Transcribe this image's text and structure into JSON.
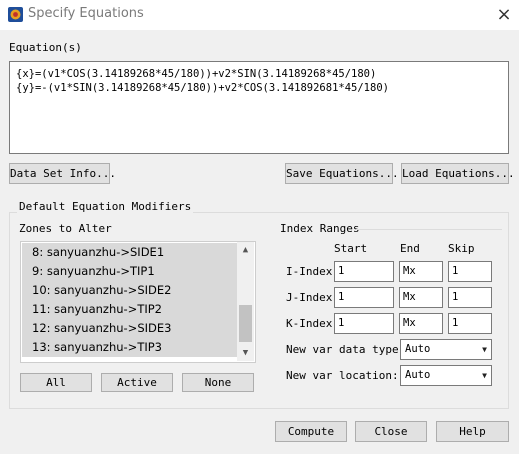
{
  "window": {
    "title": "Specify Equations",
    "close_icon": "×"
  },
  "equations": {
    "label": "Equation(s)",
    "lines": [
      "{x}=(v1*COS(3.14189268*45/180))+v2*SIN(3.14189268*45/180)",
      "{y}=-(v1*SIN(3.14189268*45/180))+v2*COS(3.141892681*45/180)"
    ]
  },
  "buttons": {
    "data_set_info": "Data Set Info...",
    "save_equations": "Save Equations...",
    "load_equations": "Load Equations...",
    "all": "All",
    "active": "Active",
    "none": "None",
    "compute": "Compute",
    "close": "Close",
    "help": "Help"
  },
  "modifiers": {
    "group_title": "Default Equation Modifiers",
    "zones_label": "Zones to Alter",
    "zones": [
      "8: sanyuanzhu->SIDE1",
      "9: sanyuanzhu->TIP1",
      "10: sanyuanzhu->SIDE2",
      "11: sanyuanzhu->TIP2",
      "12: sanyuanzhu->SIDE3",
      "13: sanyuanzhu->TIP3"
    ],
    "scroll_up_icon": "▲",
    "scroll_down_icon": "▼"
  },
  "index_ranges": {
    "title": "Index Ranges",
    "col_start": "Start",
    "col_end": "End",
    "col_skip": "Skip",
    "rows": [
      {
        "label": "I-Index",
        "start": "1",
        "end": "Mx",
        "skip": "1"
      },
      {
        "label": "J-Index",
        "start": "1",
        "end": "Mx",
        "skip": "1"
      },
      {
        "label": "K-Index",
        "start": "1",
        "end": "Mx",
        "skip": "1"
      }
    ]
  },
  "new_var": {
    "type_label": "New var data type:",
    "type_value": "Auto",
    "location_label": "New var location:",
    "location_value": "Auto"
  }
}
